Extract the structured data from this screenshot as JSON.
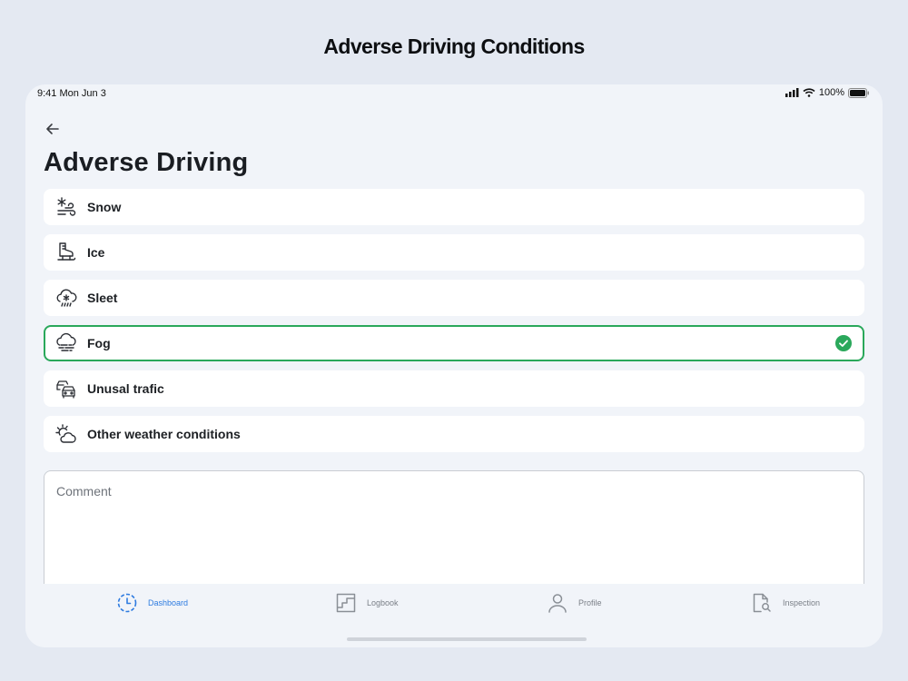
{
  "page_heading": "Adverse Driving Conditions",
  "status_bar": {
    "time": "9:41  Mon Jun 3",
    "battery": "100%"
  },
  "screen": {
    "title": "Adverse Driving"
  },
  "options": [
    {
      "label": "Snow",
      "icon": "snow-wind-icon",
      "selected": false
    },
    {
      "label": "Ice",
      "icon": "ice-skate-icon",
      "selected": false
    },
    {
      "label": "Sleet",
      "icon": "sleet-cloud-icon",
      "selected": false
    },
    {
      "label": "Fog",
      "icon": "fog-cloud-icon",
      "selected": true
    },
    {
      "label": "Unusal trafic",
      "icon": "traffic-cars-icon",
      "selected": false
    },
    {
      "label": "Other weather conditions",
      "icon": "sun-cloud-icon",
      "selected": false
    }
  ],
  "comment": {
    "placeholder": "Comment",
    "value": ""
  },
  "tabs": [
    {
      "label": "Dashboard",
      "icon": "dashboard-clock-icon",
      "active": true
    },
    {
      "label": "Logbook",
      "icon": "logbook-icon",
      "active": false
    },
    {
      "label": "Profile",
      "icon": "profile-icon",
      "active": false
    },
    {
      "label": "Inspection",
      "icon": "inspection-icon",
      "active": false
    }
  ],
  "colors": {
    "selected_border": "#2aa85b",
    "active_tab": "#2e7be0",
    "background": "#e4e9f2",
    "device": "#f1f4f9"
  }
}
